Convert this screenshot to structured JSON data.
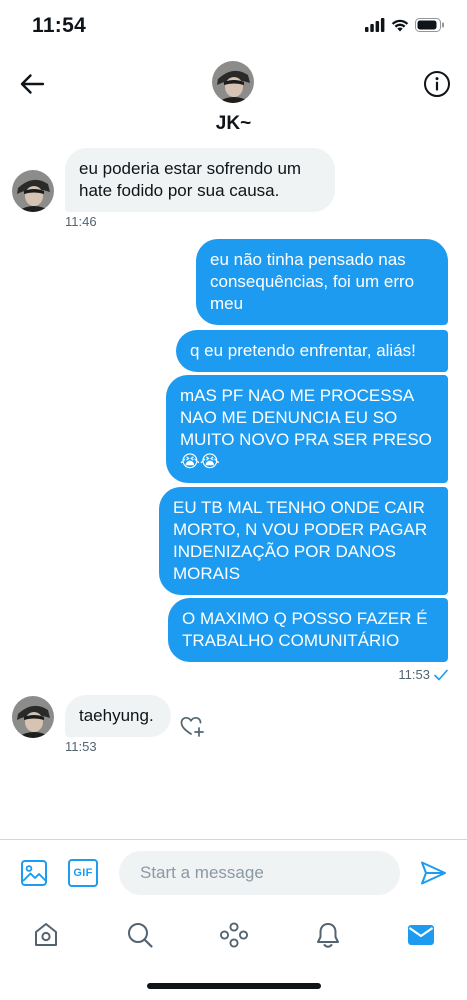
{
  "status_bar": {
    "time": "11:54"
  },
  "header": {
    "name": "JK~"
  },
  "messages": [
    {
      "text": "eu poderia estar sofrendo um\nhate fodido por sua causa.",
      "time": "11:46"
    },
    {
      "text": "eu não tinha pensado nas\nconsequências, foi um erro\nmeu"
    },
    {
      "text": "q eu pretendo enfrentar, aliás!"
    },
    {
      "text": "mAS PF NAO ME PROCESSA\nNAO ME DENUNCIA EU SO\nMUITO NOVO PRA SER PRESO\n😭😭"
    },
    {
      "text": "EU TB MAL TENHO ONDE CAIR\nMORTO, N VOU PODER PAGAR\nINDENIZAÇÃO POR DANOS\nMORAIS"
    },
    {
      "text": "O MAXIMO Q POSSO FAZER É\nTRABALHO COMUNITÁRIO",
      "time": "11:53"
    },
    {
      "text": "taehyung.",
      "time": "11:53"
    }
  ],
  "composer": {
    "placeholder": "Start a message",
    "gif_label": "GIF"
  },
  "icons": {
    "back": "back-arrow-icon",
    "info": "info-icon",
    "image": "image-icon",
    "gif": "gif-icon",
    "send": "send-icon",
    "like": "heart-plus-icon",
    "read": "checkmark-icon",
    "tabs": [
      "home-icon",
      "search-icon",
      "spaces-icon",
      "notifications-icon",
      "messages-icon"
    ]
  },
  "colors": {
    "accent": "#1d9bf0",
    "incoming_bubble": "#eff3f4",
    "text": "#0f1419",
    "muted": "#536471"
  }
}
